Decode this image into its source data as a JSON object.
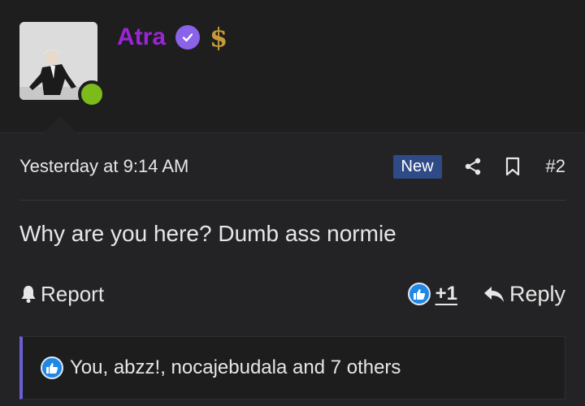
{
  "user": {
    "username": "Atra",
    "username_color": "#9b25d6",
    "avatar_alt": "user-avatar",
    "online_status_color": "#7cbb19",
    "verified_icon": "verified-check-icon",
    "badge_icon": "dollar-sign-icon",
    "badge_symbol": "$"
  },
  "post": {
    "timestamp": "Yesterday at 9:14 AM",
    "new_badge": "New",
    "share_icon": "share-icon",
    "bookmark_icon": "bookmark-icon",
    "post_number": "#2",
    "message": "Why are you here? Dumb ass normie"
  },
  "actions": {
    "report_label": "Report",
    "report_icon": "bell-icon",
    "like_icon": "thumbs-up-icon",
    "like_count": "+1",
    "reply_label": "Reply",
    "reply_icon": "reply-arrow-icon"
  },
  "reactions": {
    "icon": "thumbs-up-icon",
    "text": "You, abzz!, nocajebudala and 7 others",
    "accent_color": "#6a5fd0"
  },
  "colors": {
    "background": "#232325",
    "header_bg": "#1e1e1f",
    "new_badge_bg": "#2f4a86",
    "like_blue": "#1f88e5"
  }
}
